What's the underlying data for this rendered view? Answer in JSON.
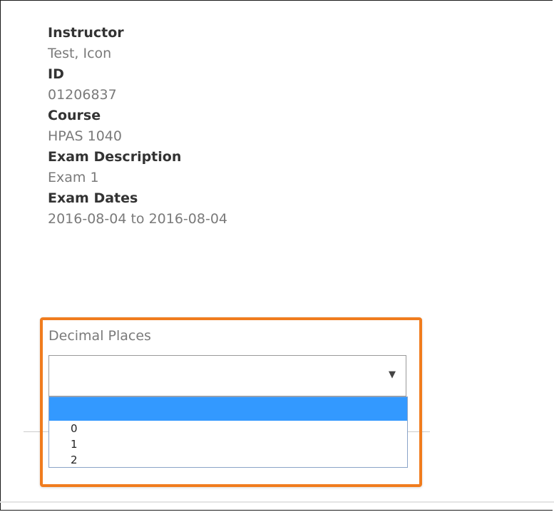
{
  "exam_details": [
    {
      "label": "Instructor",
      "value": "Test, Icon"
    },
    {
      "label": "ID",
      "value": "01206837"
    },
    {
      "label": "Course",
      "value": "HPAS 1040"
    },
    {
      "label": "Exam Description",
      "value": "Exam 1"
    },
    {
      "label": "Exam Dates",
      "value": "2016-08-04 to 2016-08-04"
    }
  ],
  "decimal_places": {
    "label": "Decimal Places",
    "selected_value": "",
    "arrow_icon": "triangle-down-icon",
    "options": [
      "",
      "0",
      "1",
      "2"
    ]
  },
  "colors": {
    "highlight": "#f07c1e",
    "selected_option": "#3399ff",
    "label_text": "#333333",
    "value_text": "#7a7a7a"
  }
}
